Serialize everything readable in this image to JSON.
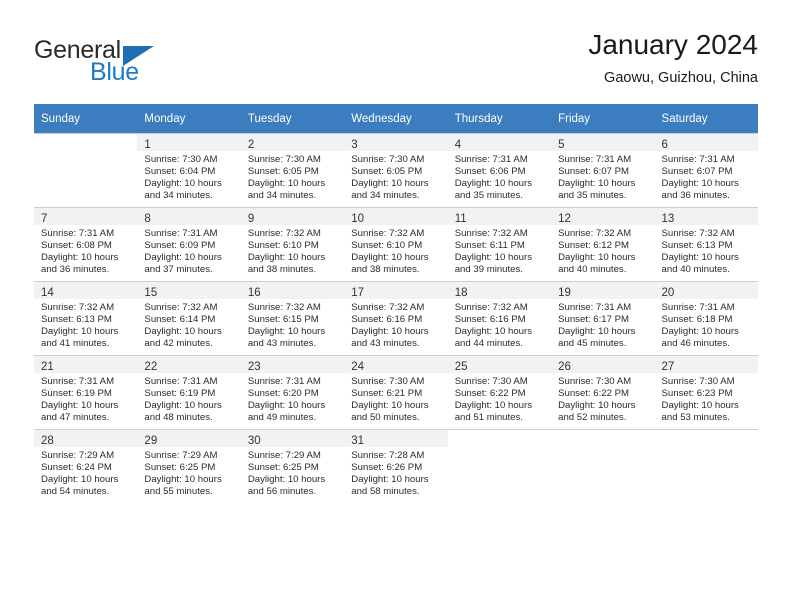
{
  "brand": {
    "name_part1": "General",
    "name_part2": "Blue",
    "logo_icon": "triangle-flag-icon",
    "color_blue": "#1f7ac4",
    "color_dark": "#2a2a2a"
  },
  "header": {
    "title": "January 2024",
    "subtitle": "Gaowu, Guizhou, China"
  },
  "theme": {
    "header_row_bg": "#3b7dbf",
    "header_row_text": "#ffffff",
    "daynum_shade": "#f2f2f2",
    "grid_line": "#cfcfcf"
  },
  "calendar": {
    "weekday_headers": [
      "Sunday",
      "Monday",
      "Tuesday",
      "Wednesday",
      "Thursday",
      "Friday",
      "Saturday"
    ],
    "weeks": [
      [
        {
          "day": "",
          "lines": []
        },
        {
          "day": "1",
          "lines": [
            "Sunrise: 7:30 AM",
            "Sunset: 6:04 PM",
            "Daylight: 10 hours",
            "and 34 minutes."
          ]
        },
        {
          "day": "2",
          "lines": [
            "Sunrise: 7:30 AM",
            "Sunset: 6:05 PM",
            "Daylight: 10 hours",
            "and 34 minutes."
          ]
        },
        {
          "day": "3",
          "lines": [
            "Sunrise: 7:30 AM",
            "Sunset: 6:05 PM",
            "Daylight: 10 hours",
            "and 34 minutes."
          ]
        },
        {
          "day": "4",
          "lines": [
            "Sunrise: 7:31 AM",
            "Sunset: 6:06 PM",
            "Daylight: 10 hours",
            "and 35 minutes."
          ]
        },
        {
          "day": "5",
          "lines": [
            "Sunrise: 7:31 AM",
            "Sunset: 6:07 PM",
            "Daylight: 10 hours",
            "and 35 minutes."
          ]
        },
        {
          "day": "6",
          "lines": [
            "Sunrise: 7:31 AM",
            "Sunset: 6:07 PM",
            "Daylight: 10 hours",
            "and 36 minutes."
          ]
        }
      ],
      [
        {
          "day": "7",
          "lines": [
            "Sunrise: 7:31 AM",
            "Sunset: 6:08 PM",
            "Daylight: 10 hours",
            "and 36 minutes."
          ]
        },
        {
          "day": "8",
          "lines": [
            "Sunrise: 7:31 AM",
            "Sunset: 6:09 PM",
            "Daylight: 10 hours",
            "and 37 minutes."
          ]
        },
        {
          "day": "9",
          "lines": [
            "Sunrise: 7:32 AM",
            "Sunset: 6:10 PM",
            "Daylight: 10 hours",
            "and 38 minutes."
          ]
        },
        {
          "day": "10",
          "lines": [
            "Sunrise: 7:32 AM",
            "Sunset: 6:10 PM",
            "Daylight: 10 hours",
            "and 38 minutes."
          ]
        },
        {
          "day": "11",
          "lines": [
            "Sunrise: 7:32 AM",
            "Sunset: 6:11 PM",
            "Daylight: 10 hours",
            "and 39 minutes."
          ]
        },
        {
          "day": "12",
          "lines": [
            "Sunrise: 7:32 AM",
            "Sunset: 6:12 PM",
            "Daylight: 10 hours",
            "and 40 minutes."
          ]
        },
        {
          "day": "13",
          "lines": [
            "Sunrise: 7:32 AM",
            "Sunset: 6:13 PM",
            "Daylight: 10 hours",
            "and 40 minutes."
          ]
        }
      ],
      [
        {
          "day": "14",
          "lines": [
            "Sunrise: 7:32 AM",
            "Sunset: 6:13 PM",
            "Daylight: 10 hours",
            "and 41 minutes."
          ]
        },
        {
          "day": "15",
          "lines": [
            "Sunrise: 7:32 AM",
            "Sunset: 6:14 PM",
            "Daylight: 10 hours",
            "and 42 minutes."
          ]
        },
        {
          "day": "16",
          "lines": [
            "Sunrise: 7:32 AM",
            "Sunset: 6:15 PM",
            "Daylight: 10 hours",
            "and 43 minutes."
          ]
        },
        {
          "day": "17",
          "lines": [
            "Sunrise: 7:32 AM",
            "Sunset: 6:16 PM",
            "Daylight: 10 hours",
            "and 43 minutes."
          ]
        },
        {
          "day": "18",
          "lines": [
            "Sunrise: 7:32 AM",
            "Sunset: 6:16 PM",
            "Daylight: 10 hours",
            "and 44 minutes."
          ]
        },
        {
          "day": "19",
          "lines": [
            "Sunrise: 7:31 AM",
            "Sunset: 6:17 PM",
            "Daylight: 10 hours",
            "and 45 minutes."
          ]
        },
        {
          "day": "20",
          "lines": [
            "Sunrise: 7:31 AM",
            "Sunset: 6:18 PM",
            "Daylight: 10 hours",
            "and 46 minutes."
          ]
        }
      ],
      [
        {
          "day": "21",
          "lines": [
            "Sunrise: 7:31 AM",
            "Sunset: 6:19 PM",
            "Daylight: 10 hours",
            "and 47 minutes."
          ]
        },
        {
          "day": "22",
          "lines": [
            "Sunrise: 7:31 AM",
            "Sunset: 6:19 PM",
            "Daylight: 10 hours",
            "and 48 minutes."
          ]
        },
        {
          "day": "23",
          "lines": [
            "Sunrise: 7:31 AM",
            "Sunset: 6:20 PM",
            "Daylight: 10 hours",
            "and 49 minutes."
          ]
        },
        {
          "day": "24",
          "lines": [
            "Sunrise: 7:30 AM",
            "Sunset: 6:21 PM",
            "Daylight: 10 hours",
            "and 50 minutes."
          ]
        },
        {
          "day": "25",
          "lines": [
            "Sunrise: 7:30 AM",
            "Sunset: 6:22 PM",
            "Daylight: 10 hours",
            "and 51 minutes."
          ]
        },
        {
          "day": "26",
          "lines": [
            "Sunrise: 7:30 AM",
            "Sunset: 6:22 PM",
            "Daylight: 10 hours",
            "and 52 minutes."
          ]
        },
        {
          "day": "27",
          "lines": [
            "Sunrise: 7:30 AM",
            "Sunset: 6:23 PM",
            "Daylight: 10 hours",
            "and 53 minutes."
          ]
        }
      ],
      [
        {
          "day": "28",
          "lines": [
            "Sunrise: 7:29 AM",
            "Sunset: 6:24 PM",
            "Daylight: 10 hours",
            "and 54 minutes."
          ]
        },
        {
          "day": "29",
          "lines": [
            "Sunrise: 7:29 AM",
            "Sunset: 6:25 PM",
            "Daylight: 10 hours",
            "and 55 minutes."
          ]
        },
        {
          "day": "30",
          "lines": [
            "Sunrise: 7:29 AM",
            "Sunset: 6:25 PM",
            "Daylight: 10 hours",
            "and 56 minutes."
          ]
        },
        {
          "day": "31",
          "lines": [
            "Sunrise: 7:28 AM",
            "Sunset: 6:26 PM",
            "Daylight: 10 hours",
            "and 58 minutes."
          ]
        },
        {
          "day": "",
          "lines": []
        },
        {
          "day": "",
          "lines": []
        },
        {
          "day": "",
          "lines": []
        }
      ]
    ]
  }
}
